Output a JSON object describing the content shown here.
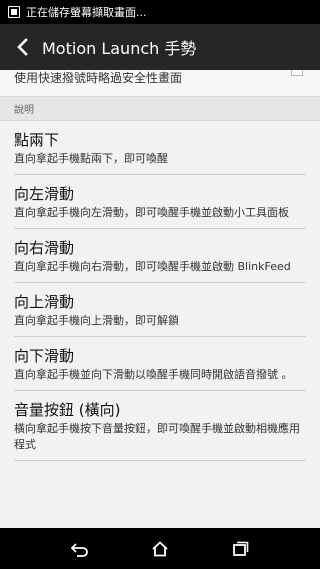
{
  "status_bar": {
    "notification_text": "正在儲存螢幕擷取畫面..."
  },
  "app_bar": {
    "title": "Motion Launch 手勢",
    "back_icon": "back-arrow-icon"
  },
  "partial_item": {
    "description": "使用快速撥號時略過安全性畫面"
  },
  "section": {
    "header": "說明"
  },
  "items": [
    {
      "title": "點兩下",
      "description": "直向拿起手機點兩下，即可喚醒"
    },
    {
      "title": "向左滑動",
      "description": "直向拿起手機向左滑動，即可喚醒手機並啟動小工具面板"
    },
    {
      "title": "向右滑動",
      "description": "直向拿起手機向右滑動，即可喚醒手機並啟動 BlinkFeed"
    },
    {
      "title": "向上滑動",
      "description": "直向拿起手機向上滑動，即可解鎖"
    },
    {
      "title": "向下滑動",
      "description": "直向拿起手機並向下滑動以喚醒手機同時開啟語音撥號 。"
    },
    {
      "title": "音量按鈕 (橫向)",
      "description": "橫向拿起手機按下音量按鈕，即可喚醒手機並啟動相機應用程式"
    }
  ],
  "nav_bar": {
    "back_icon": "nav-back-icon",
    "home_icon": "nav-home-icon",
    "recents_icon": "nav-recents-icon"
  }
}
